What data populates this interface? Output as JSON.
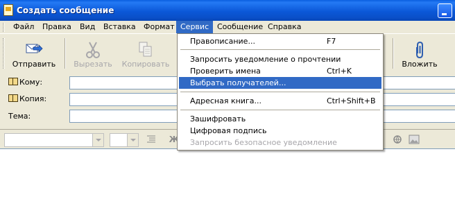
{
  "window": {
    "title": "Создать сообщение"
  },
  "menubar": {
    "items": [
      {
        "label": "Файл"
      },
      {
        "label": "Правка"
      },
      {
        "label": "Вид"
      },
      {
        "label": "Вставка"
      },
      {
        "label": "Формат"
      },
      {
        "label": "Сервис",
        "active": true
      },
      {
        "label": "Сообщение"
      },
      {
        "label": "Справка"
      }
    ]
  },
  "toolbar": {
    "send": {
      "label": "Отправить",
      "icon": "send-icon"
    },
    "cut": {
      "label": "Вырезать",
      "icon": "scissors-icon",
      "enabled": false
    },
    "copy": {
      "label": "Копировать",
      "icon": "copy-icon",
      "enabled": false
    },
    "attach": {
      "label": "Вложить",
      "icon": "paperclip-icon"
    }
  },
  "fields": {
    "to_label": "Кому:",
    "cc_label": "Копия:",
    "subject_label": "Тема:",
    "to_value": "",
    "cc_value": "",
    "subject_value": ""
  },
  "service_menu": {
    "items": [
      {
        "label": "Правописание...",
        "shortcut": "F7"
      },
      {
        "label": "Запросить уведомление о прочтении",
        "shortcut": ""
      },
      {
        "label": "Проверить имена",
        "shortcut": "Ctrl+K"
      },
      {
        "label": "Выбрать получателей...",
        "shortcut": "",
        "selected": true
      },
      {
        "label": "Адресная книга...",
        "shortcut": "Ctrl+Shift+B"
      },
      {
        "label": "Зашифровать",
        "shortcut": ""
      },
      {
        "label": "Цифровая подпись",
        "shortcut": ""
      },
      {
        "label": "Запросить безопасное уведомление",
        "shortcut": "",
        "enabled": false
      }
    ]
  },
  "colors": {
    "titlebar": "#0a5fe0",
    "highlight": "#316ac5",
    "chrome": "#ece9d8",
    "disabled_text": "#a7a6aa"
  }
}
